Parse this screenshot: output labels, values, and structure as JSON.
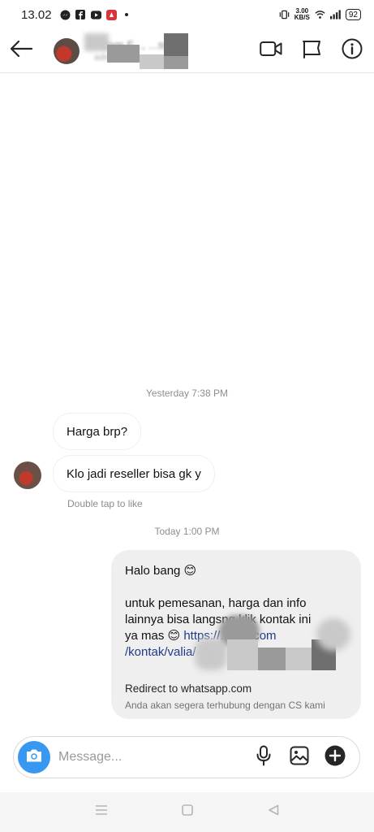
{
  "status_bar": {
    "time": "13.02",
    "net_speed_value": "3.00",
    "net_speed_unit": "KB/S",
    "battery": "92",
    "icons": [
      "messenger-icon",
      "facebook-icon",
      "youtube-icon",
      "app-icon",
      "dot-icon",
      "vibrate-icon",
      "wifi-icon",
      "signal-icon",
      "battery-icon"
    ]
  },
  "header": {
    "contact_name": "Adam F..., ...sya",
    "contact_status": "adm...",
    "icons": [
      "back-arrow-icon",
      "video-call-icon",
      "flag-icon",
      "info-icon"
    ]
  },
  "conversation": {
    "timestamp_1": "Yesterday 7:38 PM",
    "incoming": [
      {
        "text": "Harga brp?"
      },
      {
        "text": "Klo jadi reseller bisa gk y"
      }
    ],
    "like_hint": "Double tap to like",
    "timestamp_2": "Today 1:00 PM",
    "outgoing": {
      "greeting": "Halo bang 😊",
      "body_line_1": "untuk pemesanan, harga dan info",
      "body_line_2": "lainnya bisa langsng klik kontak ini",
      "body_line_3_prefix": "ya mas 😊 ",
      "link_part_1": "https://...cba.com",
      "link_part_2": "/kontak/valia/",
      "redirect_title": "Redirect to whatsapp.com",
      "redirect_subtitle": "Anda akan segera terhubung dengan CS kami"
    }
  },
  "composer": {
    "placeholder": "Message...",
    "icons": [
      "camera-icon",
      "microphone-icon",
      "gallery-icon",
      "add-icon"
    ]
  },
  "nav": {
    "icons": [
      "recents-icon",
      "home-icon",
      "back-icon"
    ]
  },
  "colors": {
    "accent": "#3897f0",
    "bubble_out": "#efefef",
    "link": "#1e3a8a",
    "meta_text": "#8e8e8e"
  }
}
